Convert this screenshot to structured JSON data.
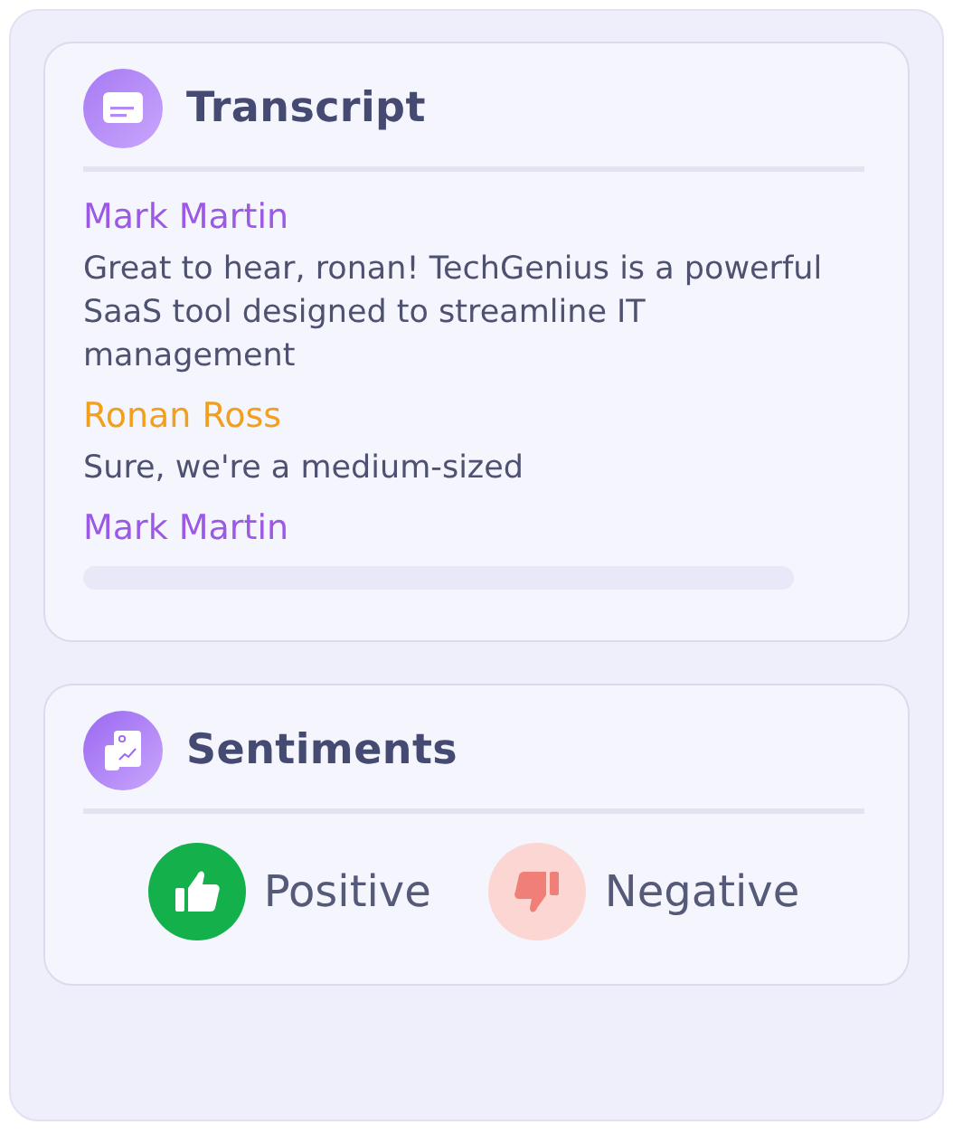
{
  "transcript": {
    "title": "Transcript",
    "messages": [
      {
        "speaker": "Mark Martin",
        "color": "#9b59e6",
        "text": "Great to hear, ronan! TechGenius is a powerful SaaS tool designed to streamline IT management"
      },
      {
        "speaker": "Ronan Ross",
        "color": "#f0a01c",
        "text": "Sure, we're a medium-sized"
      },
      {
        "speaker": "Mark Martin",
        "color": "#9b59e6"
      }
    ]
  },
  "sentiments": {
    "title": "Sentiments",
    "options": [
      {
        "kind": "positive",
        "label": "Positive",
        "selected": true
      },
      {
        "kind": "negative",
        "label": "Negative",
        "selected": false
      }
    ]
  }
}
